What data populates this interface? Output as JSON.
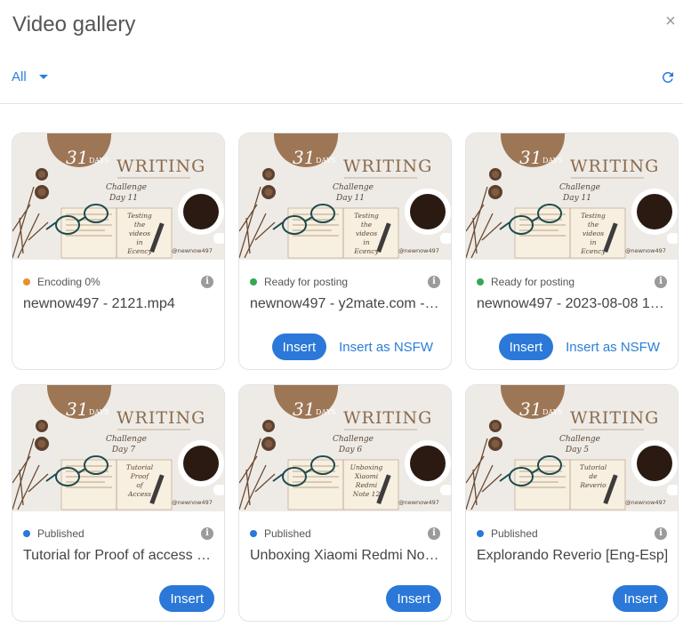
{
  "dialog": {
    "title": "Video gallery",
    "close_label": "×",
    "filter_label": "All"
  },
  "colors": {
    "encoding": "#e5922a",
    "ready": "#34a853",
    "published": "#2b78d8",
    "accent": "#2b78d8"
  },
  "thumbnail": {
    "days_number": "31",
    "days_word": "DAYS",
    "heading": "WRITING",
    "subtitle": "Challenge",
    "handle": "@newnow497"
  },
  "videos": [
    {
      "status": "Encoding 0%",
      "status_type": "encoding",
      "name": "newnow497 - 2121.mp4",
      "day": "Day 11",
      "book_text": [
        "Testing",
        "the",
        "videos",
        "in",
        "Ecency"
      ],
      "insert": "",
      "insert_nsfw": ""
    },
    {
      "status": "Ready for posting",
      "status_type": "ready",
      "name": "newnow497 - y2mate.com - …",
      "day": "Day 11",
      "book_text": [
        "Testing",
        "the",
        "videos",
        "in",
        "Ecency"
      ],
      "insert": "Insert",
      "insert_nsfw": "Insert as NSFW"
    },
    {
      "status": "Ready for posting",
      "status_type": "ready",
      "name": "newnow497 - 2023-08-08 1…",
      "day": "Day 11",
      "book_text": [
        "Testing",
        "the",
        "videos",
        "in",
        "Ecency"
      ],
      "insert": "Insert",
      "insert_nsfw": "Insert as NSFW"
    },
    {
      "status": "Published",
      "status_type": "published",
      "name": "Tutorial for Proof of access -…",
      "day": "Day 7",
      "book_text": [
        "Tutorial",
        "Proof",
        "of",
        "Access"
      ],
      "insert": "Insert",
      "insert_nsfw": ""
    },
    {
      "status": "Published",
      "status_type": "published",
      "name": "Unboxing Xiaomi Redmi Not…",
      "day": "Day 6",
      "book_text": [
        "Unboxing",
        "Xiaomi",
        "Redmi",
        "Note 12"
      ],
      "insert": "Insert",
      "insert_nsfw": ""
    },
    {
      "status": "Published",
      "status_type": "published",
      "name": "Explorando Reverio [Eng-Esp]",
      "day": "Day 5",
      "book_text": [
        "Tutorial",
        "de",
        "Reverio"
      ],
      "insert": "Insert",
      "insert_nsfw": ""
    }
  ]
}
